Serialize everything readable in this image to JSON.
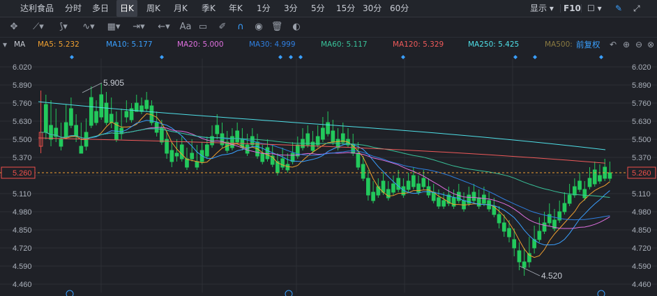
{
  "header": {
    "stock_name": "达利食品",
    "periods": [
      "分时",
      "多日",
      "日K",
      "周K",
      "月K",
      "季K",
      "年K",
      "1分",
      "3分",
      "5分",
      "15分",
      "30分",
      "60分"
    ],
    "active_period": "日K",
    "display_label": "显示",
    "f10_label": "F10"
  },
  "toolbar": {
    "text_tool_label": "Aa",
    "icons": [
      "move-icon",
      "line-tool-icon",
      "polyline-tool-icon",
      "wave-tool-icon",
      "fib-tool-icon",
      "range-tool-icon",
      "arrow-tool-icon",
      "text-tool-icon",
      "comment-icon",
      "eraser-icon",
      "magnet-icon",
      "eye-icon",
      "trash-icon",
      "toggle-icon"
    ]
  },
  "indicator": {
    "name": "MA",
    "adjust_label": "前复权",
    "items": [
      {
        "label": "MA5: 5.232",
        "color": "#f0a030"
      },
      {
        "label": "MA10: 5.177",
        "color": "#3aa0ff"
      },
      {
        "label": "MA20: 5.000",
        "color": "#e070e0"
      },
      {
        "label": "MA30: 4.999",
        "color": "#2f7fe0"
      },
      {
        "label": "MA60: 5.117",
        "color": "#39c39a"
      },
      {
        "label": "MA120: 5.329",
        "color": "#f05a5a"
      },
      {
        "label": "MA250: 5.425",
        "color": "#4fe0e8"
      },
      {
        "label": "MA500:",
        "color": "#8a7a40"
      }
    ]
  },
  "chart_data": {
    "type": "candlestick",
    "y_ticks": [
      "6.020",
      "5.890",
      "5.760",
      "5.630",
      "5.500",
      "5.370",
      "5.240",
      "5.110",
      "4.980",
      "4.850",
      "4.720",
      "4.590",
      "4.460"
    ],
    "y_range": [
      4.46,
      6.02
    ],
    "current_price": "5.260",
    "high_label": "5.905",
    "low_label": "4.520",
    "colors": {
      "up": "#f0504b",
      "down": "#23c95c"
    },
    "candles": [
      [
        5.45,
        5.85,
        5.55,
        5.4
      ],
      [
        5.75,
        5.82,
        5.55,
        5.5
      ],
      [
        5.6,
        5.78,
        5.5,
        5.45
      ],
      [
        5.58,
        5.72,
        5.52,
        5.48
      ],
      [
        5.5,
        5.62,
        5.45,
        5.42
      ],
      [
        5.62,
        5.75,
        5.52,
        5.5
      ],
      [
        5.72,
        5.8,
        5.6,
        5.58
      ],
      [
        5.6,
        5.68,
        5.52,
        5.48
      ],
      [
        5.45,
        5.62,
        5.4,
        5.4
      ],
      [
        5.55,
        5.65,
        5.45,
        5.42
      ],
      [
        5.8,
        5.88,
        5.6,
        5.58
      ],
      [
        5.7,
        5.78,
        5.62,
        5.6
      ],
      [
        5.82,
        5.9,
        5.66,
        5.64
      ],
      [
        5.76,
        5.84,
        5.62,
        5.6
      ],
      [
        5.68,
        5.8,
        5.62,
        5.58
      ],
      [
        5.62,
        5.7,
        5.5,
        5.48
      ],
      [
        5.58,
        5.72,
        5.54,
        5.5
      ],
      [
        5.7,
        5.78,
        5.66,
        5.62
      ],
      [
        5.72,
        5.76,
        5.64,
        5.62
      ],
      [
        5.76,
        5.82,
        5.7,
        5.7
      ],
      [
        5.74,
        5.8,
        5.7,
        5.68
      ],
      [
        5.78,
        5.84,
        5.72,
        5.7
      ],
      [
        5.74,
        5.78,
        5.62,
        5.6
      ],
      [
        5.62,
        5.7,
        5.55,
        5.52
      ],
      [
        5.58,
        5.64,
        5.48,
        5.46
      ],
      [
        5.5,
        5.56,
        5.4,
        5.36
      ],
      [
        5.42,
        5.48,
        5.34,
        5.3
      ],
      [
        5.4,
        5.5,
        5.38,
        5.34
      ],
      [
        5.46,
        5.52,
        5.36,
        5.34
      ],
      [
        5.36,
        5.44,
        5.3,
        5.28
      ],
      [
        5.4,
        5.5,
        5.36,
        5.34
      ],
      [
        5.34,
        5.46,
        5.3,
        5.28
      ],
      [
        5.42,
        5.48,
        5.34,
        5.32
      ],
      [
        5.46,
        5.52,
        5.38,
        5.36
      ],
      [
        5.52,
        5.6,
        5.46,
        5.44
      ],
      [
        5.6,
        5.68,
        5.54,
        5.5
      ],
      [
        5.54,
        5.62,
        5.46,
        5.44
      ],
      [
        5.48,
        5.56,
        5.42,
        5.4
      ],
      [
        5.52,
        5.58,
        5.44,
        5.42
      ],
      [
        5.56,
        5.62,
        5.48,
        5.46
      ],
      [
        5.5,
        5.58,
        5.44,
        5.42
      ],
      [
        5.46,
        5.54,
        5.4,
        5.38
      ],
      [
        5.52,
        5.58,
        5.46,
        5.44
      ],
      [
        5.48,
        5.54,
        5.38,
        5.36
      ],
      [
        5.4,
        5.46,
        5.34,
        5.32
      ],
      [
        5.44,
        5.5,
        5.36,
        5.34
      ],
      [
        5.38,
        5.46,
        5.32,
        5.3
      ],
      [
        5.34,
        5.4,
        5.26,
        5.24
      ],
      [
        5.36,
        5.44,
        5.3,
        5.28
      ],
      [
        5.32,
        5.4,
        5.28,
        5.26
      ],
      [
        5.4,
        5.48,
        5.34,
        5.32
      ],
      [
        5.46,
        5.52,
        5.38,
        5.36
      ],
      [
        5.5,
        5.58,
        5.44,
        5.42
      ],
      [
        5.54,
        5.6,
        5.46,
        5.44
      ],
      [
        5.48,
        5.56,
        5.42,
        5.4
      ],
      [
        5.52,
        5.6,
        5.46,
        5.44
      ],
      [
        5.58,
        5.66,
        5.5,
        5.48
      ],
      [
        5.62,
        5.7,
        5.54,
        5.52
      ],
      [
        5.56,
        5.64,
        5.48,
        5.46
      ],
      [
        5.5,
        5.58,
        5.44,
        5.42
      ],
      [
        5.54,
        5.62,
        5.48,
        5.46
      ],
      [
        5.5,
        5.58,
        5.46,
        5.44
      ],
      [
        5.46,
        5.54,
        5.4,
        5.38
      ],
      [
        5.4,
        5.48,
        5.3,
        5.28
      ],
      [
        5.32,
        5.38,
        5.22,
        5.2
      ],
      [
        5.22,
        5.28,
        5.1,
        5.06
      ],
      [
        5.12,
        5.2,
        5.06,
        5.04
      ],
      [
        5.16,
        5.22,
        5.1,
        5.08
      ],
      [
        5.2,
        5.26,
        5.12,
        5.1
      ],
      [
        5.14,
        5.2,
        5.08,
        5.06
      ],
      [
        5.18,
        5.24,
        5.12,
        5.1
      ],
      [
        5.22,
        5.28,
        5.14,
        5.12
      ],
      [
        5.16,
        5.22,
        5.1,
        5.08
      ],
      [
        5.2,
        5.26,
        5.14,
        5.12
      ],
      [
        5.24,
        5.3,
        5.16,
        5.14
      ],
      [
        5.18,
        5.24,
        5.12,
        5.1
      ],
      [
        5.22,
        5.28,
        5.16,
        5.14
      ],
      [
        5.16,
        5.22,
        5.1,
        5.08
      ],
      [
        5.12,
        5.18,
        5.06,
        5.04
      ],
      [
        5.08,
        5.14,
        5.02,
        5.0
      ],
      [
        5.06,
        5.12,
        5.02,
        5.0
      ],
      [
        5.1,
        5.16,
        5.04,
        5.02
      ],
      [
        5.08,
        5.14,
        5.02,
        5.0
      ],
      [
        5.12,
        5.18,
        5.06,
        5.04
      ],
      [
        5.06,
        5.12,
        5.0,
        4.98
      ],
      [
        5.1,
        5.16,
        5.04,
        5.02
      ],
      [
        5.12,
        5.18,
        5.06,
        5.04
      ],
      [
        5.08,
        5.14,
        5.02,
        5.0
      ],
      [
        5.1,
        5.16,
        5.04,
        5.02
      ],
      [
        5.06,
        5.12,
        5.0,
        4.98
      ],
      [
        5.02,
        5.08,
        4.96,
        4.94
      ],
      [
        4.96,
        5.02,
        4.9,
        4.86
      ],
      [
        4.9,
        4.96,
        4.84,
        4.8
      ],
      [
        4.86,
        4.92,
        4.8,
        4.76
      ],
      [
        4.78,
        4.86,
        4.72,
        4.66
      ],
      [
        4.7,
        4.76,
        4.62,
        4.56
      ],
      [
        4.62,
        4.72,
        4.58,
        4.52
      ],
      [
        4.68,
        4.8,
        4.62,
        4.58
      ],
      [
        4.78,
        4.88,
        4.72,
        4.68
      ],
      [
        4.84,
        4.94,
        4.78,
        4.76
      ],
      [
        4.9,
        4.98,
        4.84,
        4.82
      ],
      [
        4.96,
        5.04,
        4.9,
        4.88
      ],
      [
        4.92,
        5.0,
        4.86,
        4.84
      ],
      [
        4.98,
        5.06,
        4.92,
        4.9
      ],
      [
        5.04,
        5.12,
        4.98,
        4.96
      ],
      [
        5.1,
        5.18,
        5.04,
        5.02
      ],
      [
        5.16,
        5.22,
        5.1,
        5.08
      ],
      [
        5.2,
        5.26,
        5.14,
        5.12
      ],
      [
        5.14,
        5.2,
        5.08,
        5.06
      ],
      [
        5.22,
        5.3,
        5.16,
        5.14
      ],
      [
        5.28,
        5.34,
        5.18,
        5.16
      ],
      [
        5.24,
        5.32,
        5.2,
        5.18
      ],
      [
        5.3,
        5.36,
        5.22,
        5.2
      ],
      [
        5.26,
        5.34,
        5.22,
        5.2
      ]
    ]
  }
}
